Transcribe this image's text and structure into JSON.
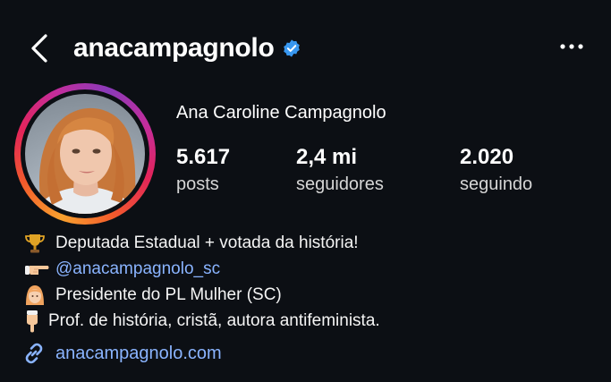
{
  "header": {
    "username": "anacampagnolo"
  },
  "profile": {
    "full_name": "Ana Caroline Campagnolo",
    "stats": [
      {
        "value": "5.617",
        "label": "posts"
      },
      {
        "value": "2,4 mi",
        "label": "seguidores"
      },
      {
        "value": "2.020",
        "label": "seguindo"
      }
    ],
    "bio": [
      {
        "icon": "trophy-emoji",
        "text": "Deputada Estadual + votada da história!"
      },
      {
        "icon": "pointing-right-emoji",
        "text": "@anacampagnolo_sc"
      },
      {
        "icon": "woman-emoji",
        "text": "Presidente do PL Mulher (SC)"
      },
      {
        "icon": "pointing-down-emoji",
        "text": "Prof. de história, cristã, autora antifeminista."
      }
    ],
    "link": "anacampagnolo.com"
  },
  "colors": {
    "background": "#0c0f14",
    "link": "#8ab4ff",
    "verified": "#3897f0"
  }
}
